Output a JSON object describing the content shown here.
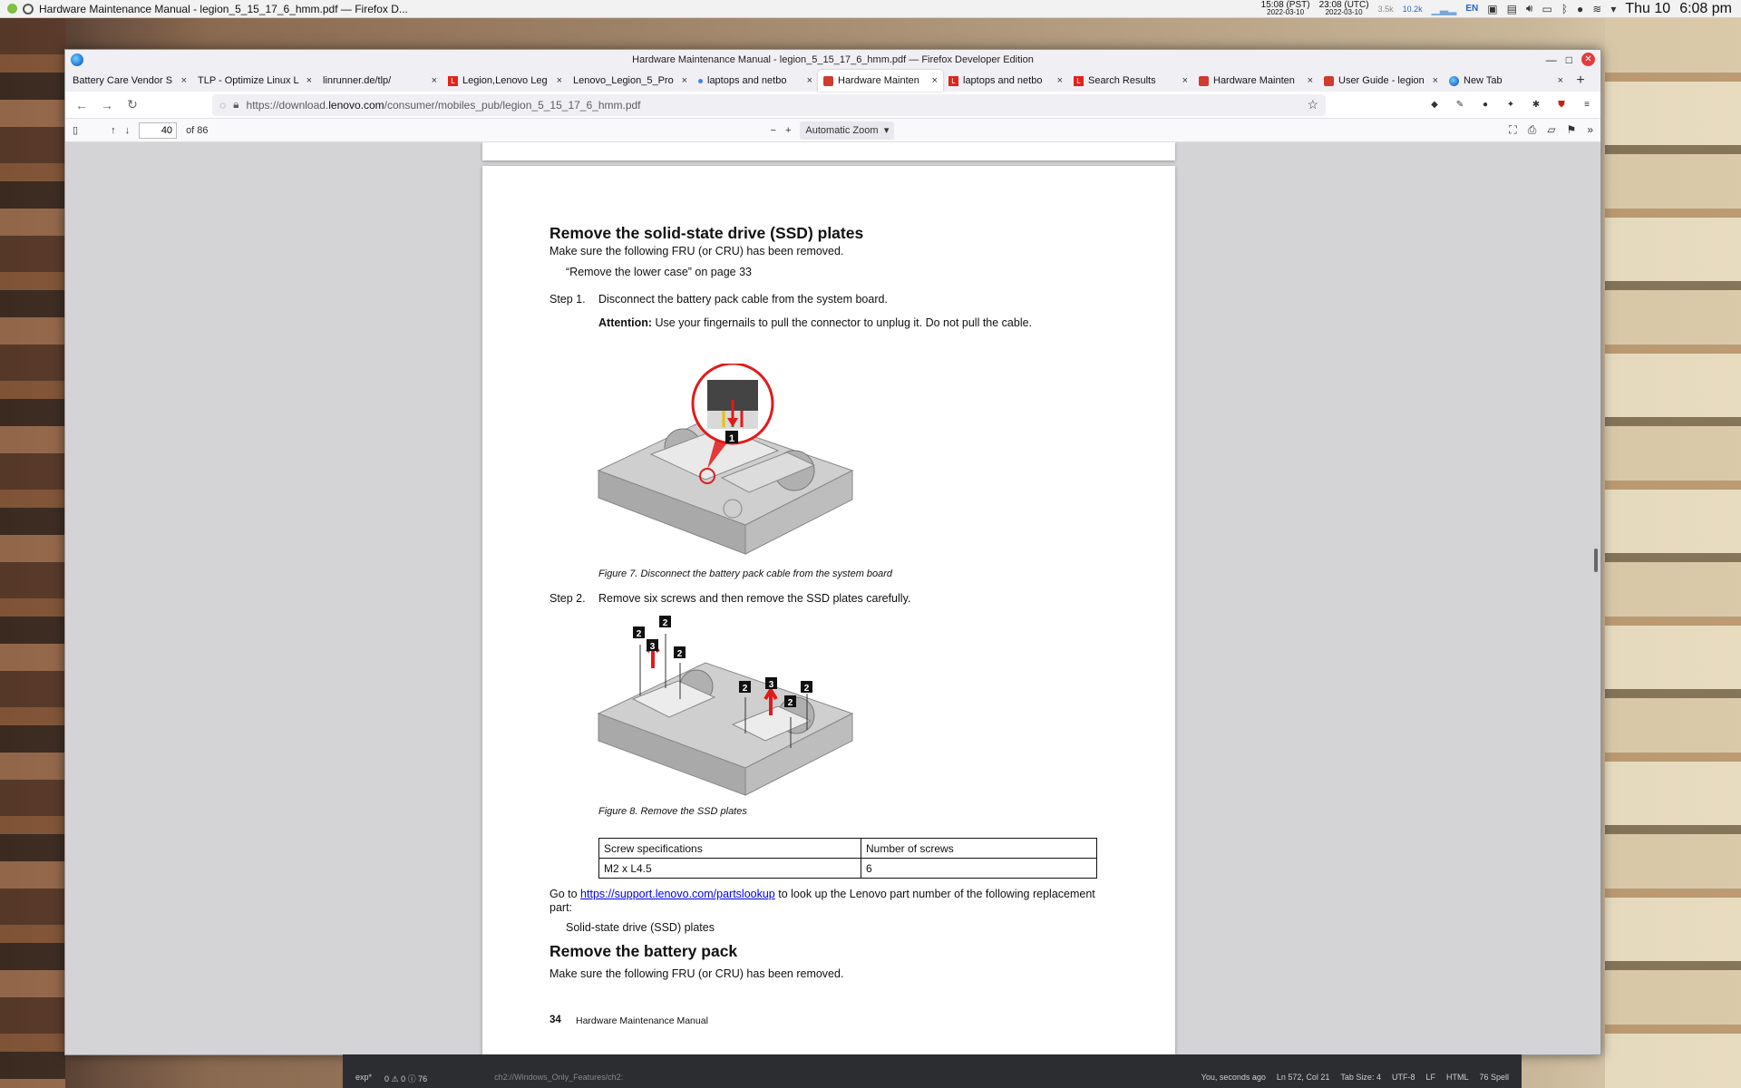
{
  "system_bar": {
    "app_title": "Hardware Maintenance Manual - legion_5_15_17_6_hmm.pdf — Firefox D...",
    "tz1": {
      "time": "15:08",
      "zone": "(PST)",
      "date": "2022-03-10"
    },
    "tz2": {
      "time": "23:08",
      "zone": "(UTC)",
      "date": "2022-03-10"
    },
    "net_down": "3.5k",
    "net_up": "10.2k",
    "lang": "EN",
    "day": "Thu 10",
    "clock": "6:08 pm"
  },
  "window": {
    "title": "Hardware Maintenance Manual - legion_5_15_17_6_hmm.pdf — Firefox Developer Edition"
  },
  "tabs": [
    {
      "label": "Battery Care Vendor S",
      "favicon": "none",
      "active": false
    },
    {
      "label": "TLP - Optimize Linux L",
      "favicon": "none",
      "active": false
    },
    {
      "label": "linrunner.de/tlp/",
      "favicon": "none",
      "active": false
    },
    {
      "label": "Legion,Lenovo Leg",
      "favicon": "lenovo",
      "active": false
    },
    {
      "label": "Lenovo_Legion_5_Pro",
      "favicon": "none",
      "active": false
    },
    {
      "label": "laptops and netbo",
      "favicon": "dot",
      "active": false
    },
    {
      "label": "Hardware Mainten",
      "favicon": "pdf",
      "active": true
    },
    {
      "label": "laptops and netbo",
      "favicon": "lenovo",
      "active": false
    },
    {
      "label": "Search Results",
      "favicon": "lenovo",
      "active": false
    },
    {
      "label": "Hardware Mainten",
      "favicon": "pdf",
      "active": false
    },
    {
      "label": "User Guide - legion",
      "favicon": "pdf",
      "active": false
    },
    {
      "label": "New Tab",
      "favicon": "ff",
      "active": false
    }
  ],
  "navbar": {
    "url_prefix": "https://download.",
    "url_domain": "lenovo.com",
    "url_path": "/consumer/mobiles_pub/legion_5_15_17_6_hmm.pdf"
  },
  "pdf_toolbar": {
    "page_number": "40",
    "page_total": "of 86",
    "zoom": "Automatic Zoom"
  },
  "page": {
    "section1_title": "Remove the solid-state drive (SSD) plates",
    "prereq1": "Make sure the following FRU (or CRU) has been removed.",
    "prereq1_item": "“Remove the lower case” on page 33",
    "step1_label": "Step 1.",
    "step1_text": "Disconnect the battery pack cable from the system board.",
    "attention_label": "Attention:",
    "attention_text": "Use your fingernails to pull the connector to unplug it. Do not pull the cable.",
    "fig7_callout": "1",
    "fig7_caption": "Figure 7. Disconnect the battery pack cable from the system board",
    "step2_label": "Step 2.",
    "step2_text": "Remove six screws and then remove the SSD plates carefully.",
    "fig8_callout_screw": "2",
    "fig8_callout_lift": "3",
    "fig8_caption": "Figure 8. Remove the SSD plates",
    "table": {
      "headers": [
        "Screw specifications",
        "Number of screws"
      ],
      "rows": [
        [
          "M2 x L4.5",
          "6"
        ]
      ]
    },
    "goto_prefix": "Go to ",
    "goto_link": "https://support.lenovo.com/partslookup",
    "goto_suffix": " to look up the Lenovo part number of the following replacement",
    "goto_line2": "part:",
    "part_item": "Solid-state drive (SSD) plates",
    "section2_title": "Remove the battery pack",
    "prereq2": "Make sure the following FRU (or CRU) has been removed.",
    "footer_page": "34",
    "footer_title": "Hardware Maintenance Manual"
  },
  "editor_status": {
    "branch": "exp*",
    "problems": "0 ⚠ 0 ⓘ 76",
    "path": "ch2://Windows_Only_Features/ch2:",
    "blame": "You, seconds ago",
    "cursor": "Ln 572, Col 21",
    "tab_size": "Tab Size: 4",
    "encoding": "UTF-8",
    "eol": "LF",
    "lang": "HTML",
    "spell": "76 Spell"
  },
  "colors": {
    "link": "#0000ee",
    "lenovo_red": "#e2231a",
    "callout_red": "#e01b1b"
  }
}
